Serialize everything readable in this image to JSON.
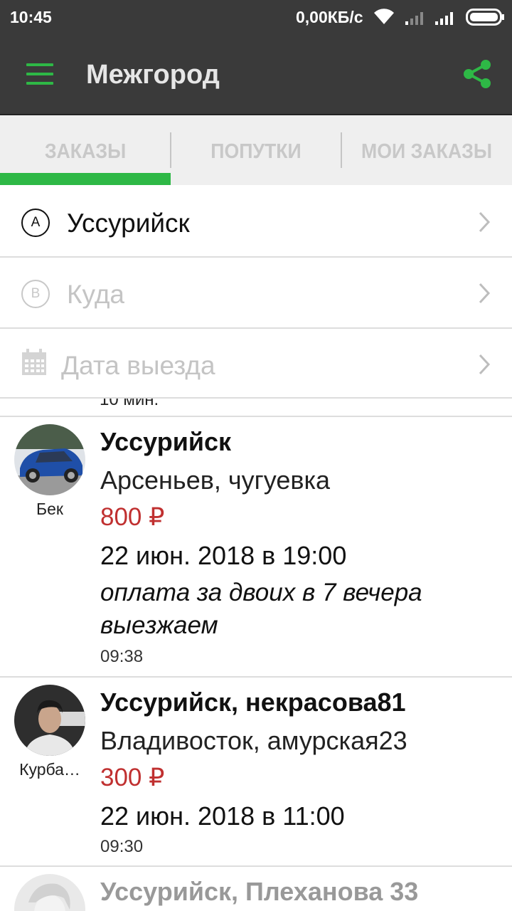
{
  "status_bar": {
    "time": "10:45",
    "network_speed": "0,00КБ/с"
  },
  "toolbar": {
    "title": "Межгород",
    "menu_icon": "menu-icon",
    "share_icon": "share-icon"
  },
  "tabs": [
    {
      "label": "ЗАКАЗЫ",
      "active": true
    },
    {
      "label": "ПОПУТКИ",
      "active": false
    },
    {
      "label": "МОИ ЗАКАЗЫ",
      "active": false
    }
  ],
  "filters": {
    "from": {
      "letter": "A",
      "value": "Уссурийск"
    },
    "to": {
      "letter": "B",
      "placeholder": "Куда"
    },
    "date": {
      "placeholder": "Дата выезда"
    }
  },
  "list": {
    "cut_text": "10 мин.",
    "items": [
      {
        "driver": "Бек",
        "from": "Уссурийск",
        "to": "Арсеньев, чугуевка",
        "price": "800 ₽",
        "date": "22 июн. 2018 в 19:00",
        "comment": "оплата за двоих в 7 вечера выезжаем",
        "time": "09:38"
      },
      {
        "driver": "Курба…",
        "from": "Уссурийск, некрасова81",
        "to": "Владивосток, амурская23",
        "price": "300 ₽",
        "date": "22 июн. 2018 в 11:00",
        "time": "09:30"
      },
      {
        "from": "Уссурийск, Плеханова 33"
      }
    ]
  },
  "colors": {
    "accent": "#2eb846",
    "toolbar": "#3a3a3a",
    "price": "#c03030"
  }
}
